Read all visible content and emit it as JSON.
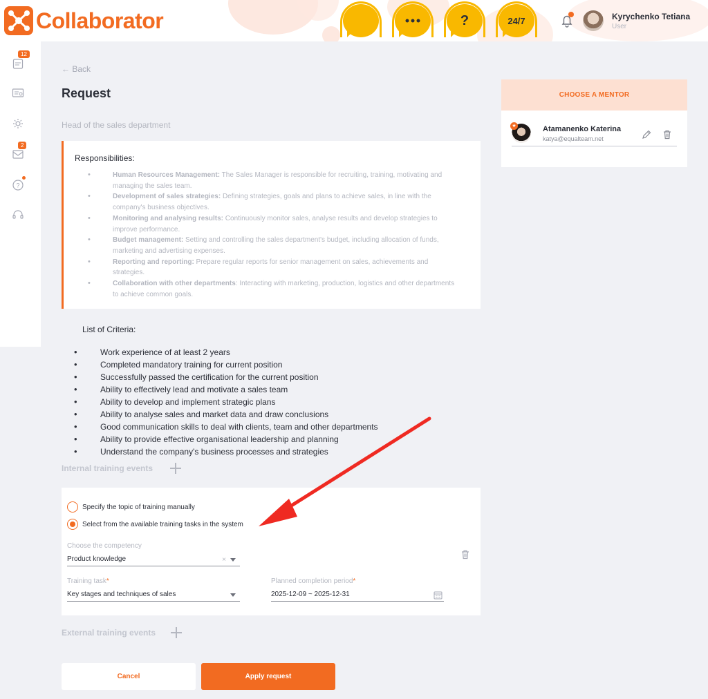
{
  "app": {
    "brand": "Collaborator",
    "support_labels": [
      "",
      "",
      "?",
      "24/7"
    ],
    "accent": "#f26b21",
    "support_color": "#f9b800"
  },
  "user": {
    "name": "Kyrychenko Tetiana",
    "role": "User"
  },
  "sidebar": {
    "badges": {
      "tasks": "12",
      "messages": "2"
    }
  },
  "page": {
    "back": "← Back",
    "title": "Request",
    "position": "Head of the sales department"
  },
  "responsibilities": {
    "title": "Responsibilities:",
    "items": [
      {
        "bold": "Human Resources Management:",
        "text": " The Sales Manager is responsible for recruiting, training, motivating and managing the sales team."
      },
      {
        "bold": "Development of sales strategies:",
        "text": " Defining strategies, goals and plans to achieve sales, in line with the company's business objectives."
      },
      {
        "bold": "Monitoring and analysing results:",
        "text": " Continuously monitor sales, analyse results and develop strategies to improve performance."
      },
      {
        "bold": "Budget management:",
        "text": " Setting and controlling the sales department's budget, including allocation of funds, marketing and advertising expenses."
      },
      {
        "bold": "Reporting and reporting:",
        "text": " Prepare regular reports for senior management on sales, achievements and strategies."
      },
      {
        "bold": "Collaboration with other departments",
        "text": ": Interacting with marketing, production, logistics and other departments to achieve common goals."
      }
    ]
  },
  "criteria": {
    "title": "List of Criteria:",
    "items": [
      "Work experience of at least 2 years",
      "Completed mandatory training for current position",
      "Successfully passed the certification for the current position",
      "Ability to effectively lead and motivate a sales team",
      "Ability to develop and implement strategic plans",
      "Ability to analyse sales and market data and draw conclusions",
      "Good communication skills to deal with clients, team and other departments",
      "Ability to provide effective organisational leadership and planning",
      "Understand the company's business processes and strategies"
    ]
  },
  "training": {
    "internal_label": "Internal training events",
    "external_label": "External training events",
    "option_manual": "Specify the topic of training manually",
    "option_system": "Select from the available training tasks in the system",
    "competency_label": "Choose the competency",
    "competency_value": "Product knowledge",
    "task_label": "Training task",
    "task_value": "Key stages and techniques of sales",
    "period_label": "Planned completion period",
    "period_value": "2025-12-09 ~ 2025-12-31",
    "required_mark": "*",
    "clear_mark": "×"
  },
  "actions": {
    "cancel": "Cancel",
    "apply": "Apply request"
  },
  "mentor": {
    "header": "CHOOSE A MENTOR",
    "name": "Atamanenko Katerina",
    "email": "katya@equalteam.net"
  }
}
